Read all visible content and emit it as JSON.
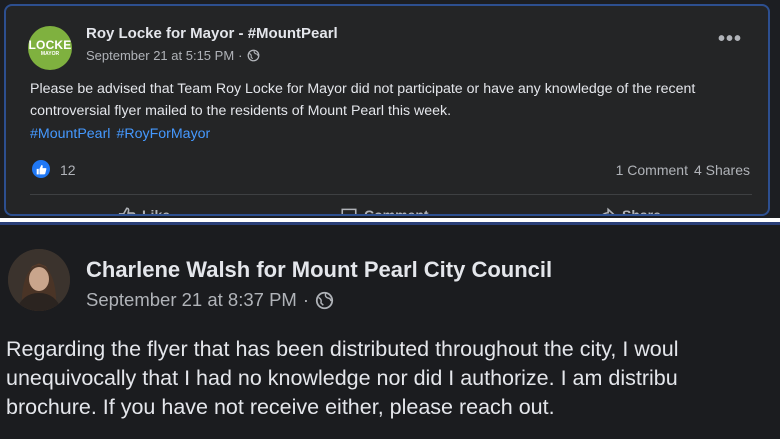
{
  "top_post": {
    "logo": {
      "main": "LOCKE",
      "sub": "MAYOR",
      "color": "#7fb13f"
    },
    "page_name": "Roy Locke for Mayor - #MountPearl",
    "timestamp": "September 21 at 5:15 PM",
    "separator": "·",
    "privacy_icon": "globe-icon",
    "body": "Please be advised that Team Roy Locke for Mayor did not participate or have any knowledge of the recent controversial flyer mailed to the residents of Mount Pearl this week.",
    "hashtags": [
      "#MountPearl",
      "#RoyForMayor"
    ],
    "reaction_count": "12",
    "comments": "1 Comment",
    "shares": "4 Shares",
    "actions": {
      "like": "Like",
      "comment": "Comment",
      "share": "Share"
    },
    "more_icon": "more-options-icon"
  },
  "bottom_post": {
    "page_name": "Charlene Walsh for Mount Pearl City Council",
    "timestamp": "September 21 at 8:37 PM",
    "separator": "·",
    "privacy_icon": "globe-icon",
    "body_lines": [
      "Regarding the flyer that has been distributed throughout the city, I woul",
      "unequivocally that I had no knowledge nor did I authorize.  I am distribu",
      "brochure.  If you have not receive either, please reach out."
    ]
  },
  "colors": {
    "accent": "#2d4f8f",
    "link": "#4599ff",
    "like_blue": "#2078f4"
  }
}
